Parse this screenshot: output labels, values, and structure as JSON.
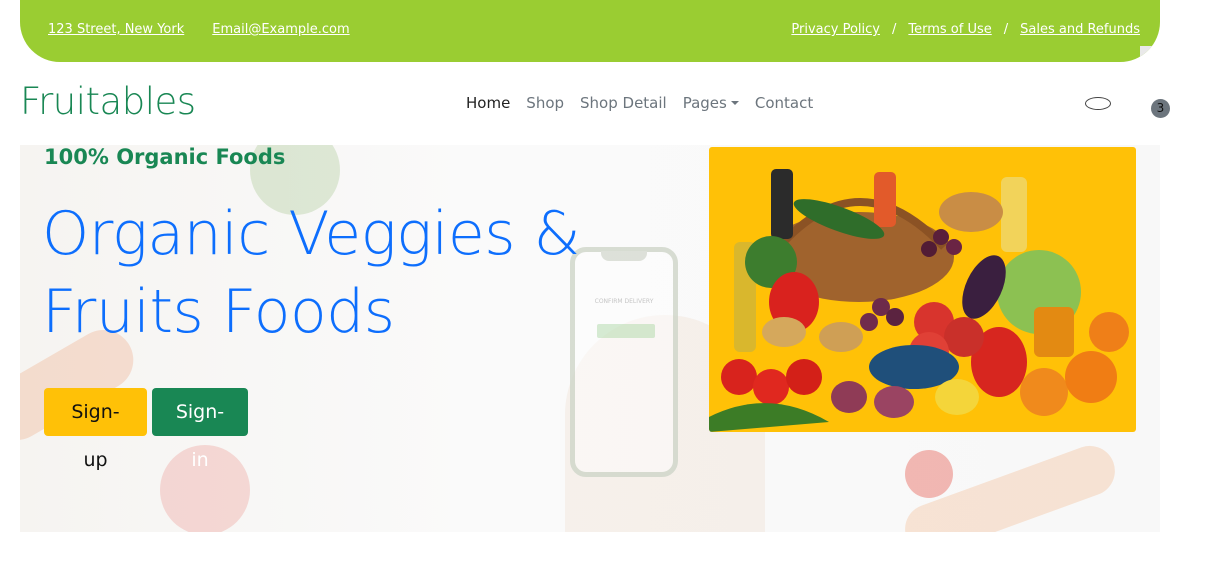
{
  "topbar": {
    "bg_color": "#9acd32",
    "address": "123 Street, New York",
    "email": "Email@Example.com",
    "links": [
      {
        "label": "Privacy Policy"
      },
      {
        "label": "Terms of Use"
      },
      {
        "label": "Sales and Refunds"
      }
    ],
    "separator": "/"
  },
  "navbar": {
    "brand": "Fruitables",
    "brand_color": "#198754",
    "items": [
      {
        "label": "Home",
        "active": true
      },
      {
        "label": "Shop"
      },
      {
        "label": "Shop Detail"
      },
      {
        "label": "Pages",
        "dropdown": true
      },
      {
        "label": "Contact"
      }
    ],
    "search_icon": "search-icon",
    "cart_count": "3"
  },
  "hero": {
    "tagline": "100% Organic Foods",
    "headline_line1": "Organic Veggies &",
    "headline_line2": "Fruits Foods",
    "headline_color": "#0d6efd",
    "phone_text": "CONFIRM DELIVERY",
    "buttons": {
      "signup": "Sign-up",
      "signin": "Sign-in"
    },
    "signup_color": "#ffc107",
    "signin_color": "#198754",
    "image_bg": "#ffc107"
  }
}
